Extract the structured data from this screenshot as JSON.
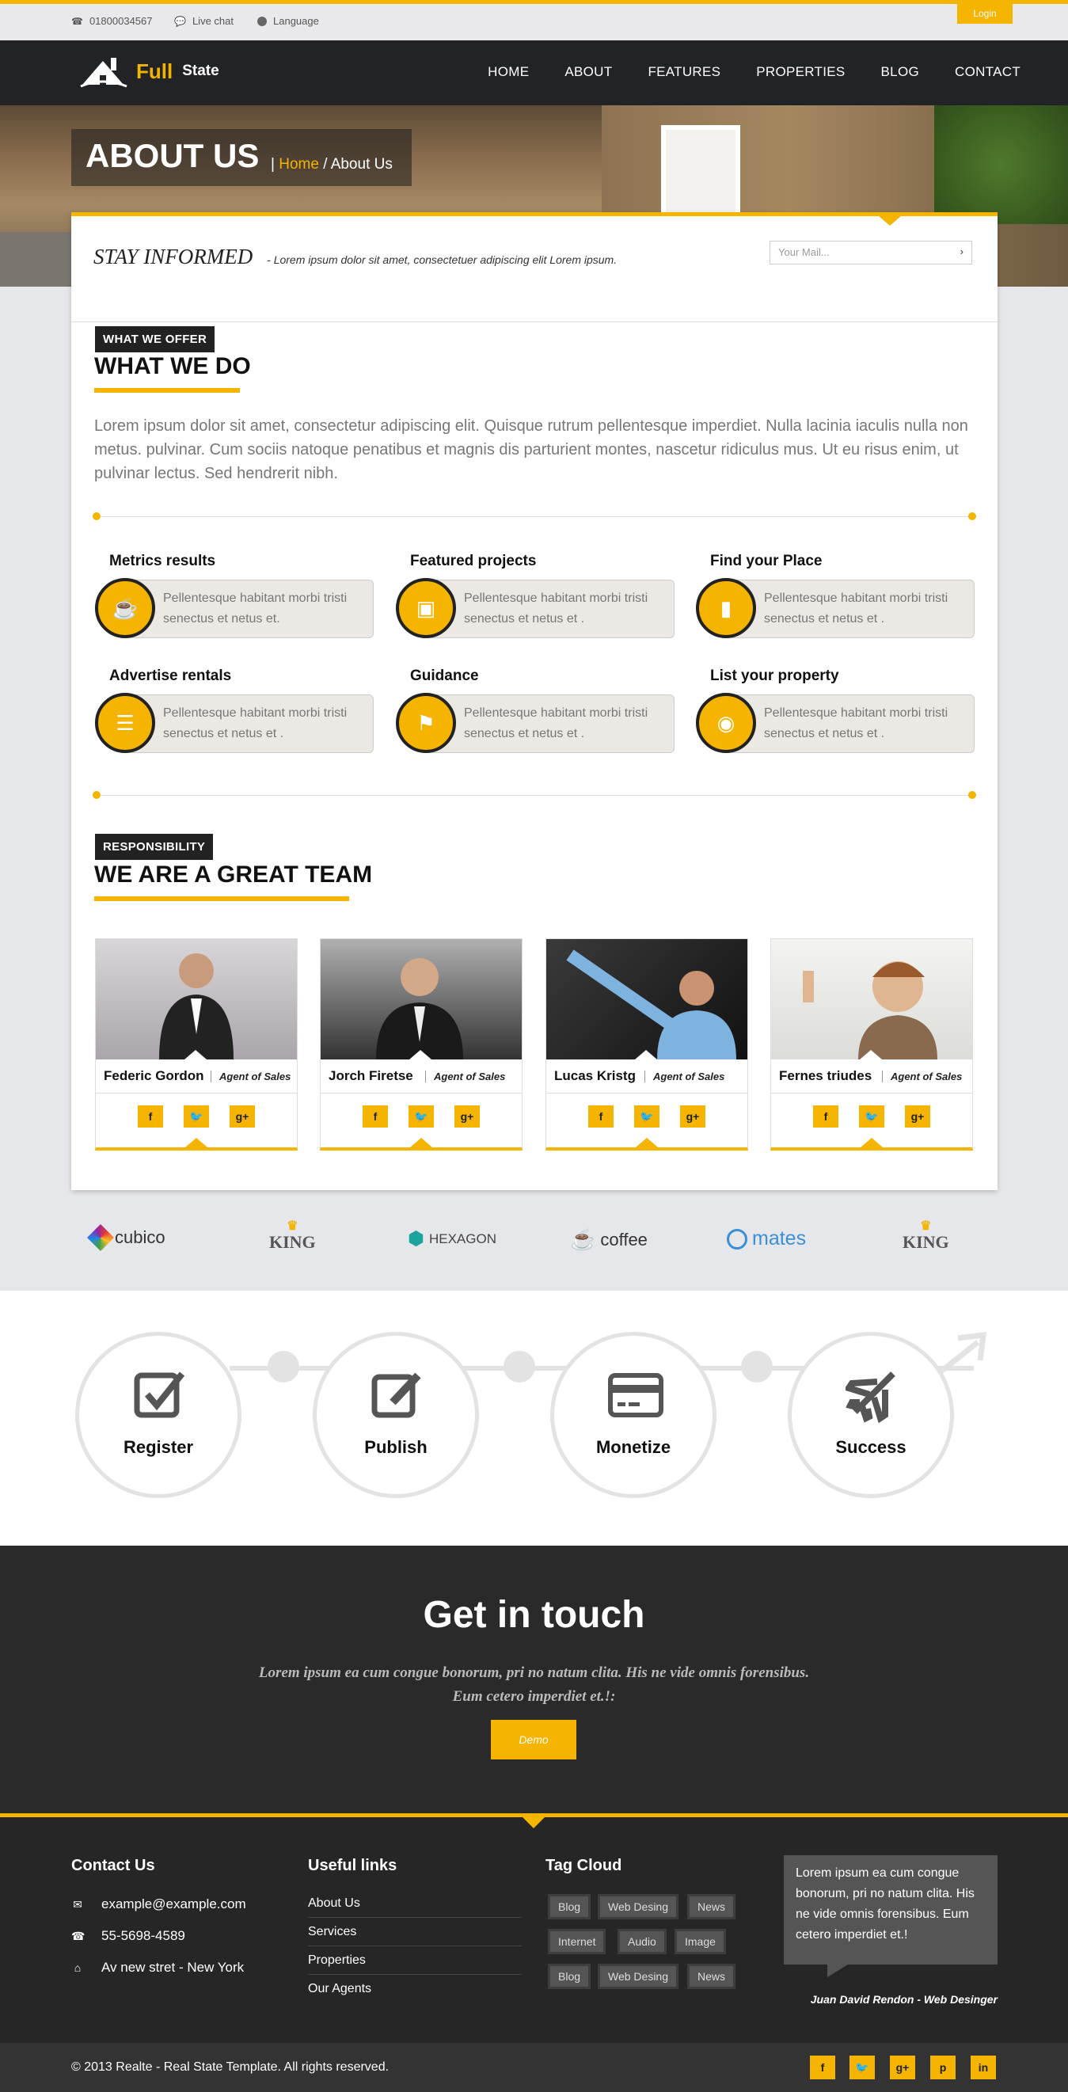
{
  "topbar": {
    "phone": "01800034567",
    "live_chat": "Live chat",
    "language": "Language",
    "login": "Login"
  },
  "nav": {
    "logo_full": "Full",
    "logo_state": "State",
    "items": [
      "HOME",
      "ABOUT",
      "FEATURES",
      "PROPERTIES",
      "BLOG",
      "CONTACT"
    ]
  },
  "hero": {
    "title": "ABOUT US",
    "breadcrumb_sep": "|",
    "breadcrumb_home": "Home",
    "breadcrumb_current": "/ About Us"
  },
  "newsletter": {
    "title": "STAY INFORMED",
    "text": "- Lorem ipsum dolor sit amet, consectetuer adipiscing elit Lorem ipsum.",
    "placeholder": "Your Mail..."
  },
  "offer": {
    "badge": "WHAT WE OFFER",
    "title": "WHAT WE DO",
    "text": "Lorem ipsum dolor sit amet, consectetur adipiscing elit. Quisque rutrum pellentesque imperdiet. Nulla lacinia iaculis nulla non metus. pulvinar. Cum sociis natoque penatibus et magnis dis parturient montes, nascetur ridiculus mus. Ut eu risus enim, ut pulvinar lectus. Sed hendrerit nibh.",
    "features": [
      {
        "title": "Metrics results",
        "text": "Pellentesque habitant morbi tristi senectus et netus et.",
        "icon": "coffee-icon"
      },
      {
        "title": "Featured projects",
        "text": "Pellentesque habitant morbi tristi senectus et netus et .",
        "icon": "monitor-icon"
      },
      {
        "title": "Find your Place",
        "text": "Pellentesque habitant morbi tristi senectus et netus et .",
        "icon": "briefcase-icon"
      },
      {
        "title": "Advertise rentals",
        "text": "Pellentesque habitant morbi tristi senectus et netus et .",
        "icon": "list-icon"
      },
      {
        "title": "Guidance",
        "text": "Pellentesque habitant morbi tristi senectus et netus et .",
        "icon": "tags-icon"
      },
      {
        "title": "List your property",
        "text": "Pellentesque habitant morbi tristi senectus et netus et .",
        "icon": "camera-icon"
      }
    ]
  },
  "team": {
    "badge": "RESPONSIBILITY",
    "title": "WE ARE A GREAT TEAM",
    "members": [
      {
        "name": "Federic Gordon",
        "role": "Agent of Sales"
      },
      {
        "name": "Jorch Firetse",
        "role": "Agent of Sales"
      },
      {
        "name": "Lucas Kristg",
        "role": "Agent of Sales"
      },
      {
        "name": "Fernes triudes",
        "role": "Agent of Sales"
      }
    ],
    "social": [
      "f",
      "t",
      "g+"
    ]
  },
  "partners": [
    "cubico",
    "KING",
    "HEXAGON",
    "coffee",
    "mates",
    "KING"
  ],
  "steps": [
    "Register",
    "Publish",
    "Monetize",
    "Success"
  ],
  "touch": {
    "title": "Get in touch",
    "text": "Lorem ipsum ea cum congue bonorum, pri no natum clita. His ne vide omnis forensibus. Eum cetero imperdiet et.!:",
    "button": "Demo"
  },
  "footer": {
    "contact_title": "Contact Us",
    "email": "example@example.com",
    "phone": "55-5698-4589",
    "address": "Av new stret - New York",
    "links_title": "Useful links",
    "links": [
      "About Us",
      "Services",
      "Properties",
      "Our Agents"
    ],
    "tags_title": "Tag Cloud",
    "tags": [
      "Blog",
      "Web Desing",
      "News",
      "Internet",
      "Audio",
      "Image",
      "Blog",
      "Web Desing",
      "News"
    ],
    "quote": "Lorem ipsum ea cum congue bonorum, pri no natum clita. His ne vide omnis forensibus. Eum cetero imperdiet et.!",
    "signature": "Juan David Rendon - Web Desinger"
  },
  "bottom": {
    "copyright": "© 2013 Realte - Real State Template. All rights reserved.",
    "social": [
      "f",
      "t",
      "g+",
      "p",
      "in"
    ]
  },
  "colors": {
    "accent": "#f4b400",
    "dark": "#222326",
    "footer": "#262626"
  }
}
